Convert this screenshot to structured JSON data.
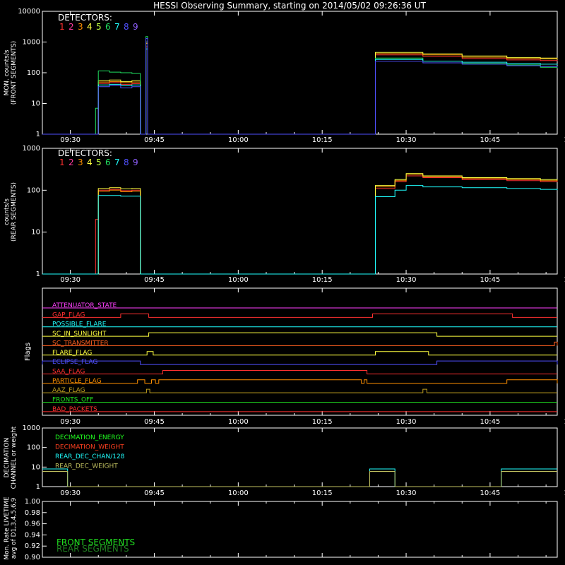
{
  "chart_data": {
    "type": "line",
    "title": "HESSI Observing Summary, starting on 2014/05/02 09:26:36 UT",
    "x_ticks": [
      "09:30",
      "09:45",
      "10:00",
      "10:15",
      "10:30",
      "10:45",
      "11:00"
    ],
    "x_range_minutes": [
      25.0,
      117.0
    ],
    "detectors_label": "DETECTORS:",
    "detector_numbers": [
      "1",
      "2",
      "3",
      "4",
      "5",
      "6",
      "7",
      "8",
      "9"
    ],
    "detector_colors": [
      "#ff3030",
      "#ff3aa0",
      "#ff9000",
      "#ffff40",
      "#c0ff40",
      "#20e060",
      "#20ffff",
      "#5050ff",
      "#9060ff"
    ],
    "panels": [
      {
        "name": "front",
        "ylabel_lines": [
          "MON. counts/s",
          "(FRONT SEGMENTS)"
        ],
        "ytick_labels": [
          "1",
          "10",
          "100",
          "1000",
          "10000"
        ],
        "ytick_values": [
          1,
          10,
          100,
          1000,
          10000
        ],
        "log": true,
        "series": [
          {
            "color": "#ff3030",
            "points": [
              [
                25,
                1
              ],
              [
                35,
                1
              ],
              [
                35,
                45
              ],
              [
                37,
                48
              ],
              [
                39,
                42
              ],
              [
                41,
                44
              ],
              [
                42.5,
                1
              ],
              [
                43.3,
                1
              ],
              [
                43.5,
                700
              ],
              [
                43.8,
                1
              ],
              [
                84.5,
                1
              ],
              [
                84.5,
                380
              ],
              [
                93,
                340
              ],
              [
                100,
                290
              ],
              [
                108,
                260
              ],
              [
                114,
                250
              ],
              [
                117,
                240
              ]
            ]
          },
          {
            "color": "#ff9000",
            "points": [
              [
                25,
                1
              ],
              [
                35,
                1
              ],
              [
                35,
                50
              ],
              [
                37,
                52
              ],
              [
                39,
                48
              ],
              [
                41,
                50
              ],
              [
                42.5,
                1
              ],
              [
                43.3,
                1
              ],
              [
                43.5,
                900
              ],
              [
                43.8,
                1
              ],
              [
                84.5,
                1
              ],
              [
                84.5,
                420
              ],
              [
                93,
                380
              ],
              [
                100,
                320
              ],
              [
                108,
                290
              ],
              [
                114,
                280
              ],
              [
                117,
                270
              ]
            ]
          },
          {
            "color": "#ffff40",
            "points": [
              [
                25,
                1
              ],
              [
                35,
                1
              ],
              [
                35,
                55
              ],
              [
                37,
                58
              ],
              [
                39,
                52
              ],
              [
                41,
                55
              ],
              [
                42.5,
                1
              ],
              [
                43.3,
                1
              ],
              [
                43.5,
                1000
              ],
              [
                43.8,
                1
              ],
              [
                84.5,
                1
              ],
              [
                84.5,
                460
              ],
              [
                93,
                410
              ],
              [
                100,
                350
              ],
              [
                108,
                310
              ],
              [
                114,
                300
              ],
              [
                117,
                290
              ]
            ]
          },
          {
            "color": "#20e060",
            "points": [
              [
                25,
                1
              ],
              [
                34.5,
                1
              ],
              [
                34.5,
                7
              ],
              [
                35,
                7
              ],
              [
                35,
                115
              ],
              [
                37,
                105
              ],
              [
                39,
                100
              ],
              [
                41,
                95
              ],
              [
                42.5,
                80
              ],
              [
                42.5,
                1
              ],
              [
                43.3,
                1
              ],
              [
                43.5,
                1500
              ],
              [
                43.8,
                1
              ],
              [
                84.5,
                1
              ],
              [
                84.5,
                300
              ],
              [
                93,
                240
              ],
              [
                100,
                200
              ],
              [
                108,
                180
              ],
              [
                114,
                150
              ],
              [
                117,
                140
              ]
            ]
          },
          {
            "color": "#20ffff",
            "points": [
              [
                25,
                1
              ],
              [
                35,
                1
              ],
              [
                35,
                40
              ],
              [
                37,
                42
              ],
              [
                39,
                38
              ],
              [
                41,
                40
              ],
              [
                42.5,
                1
              ],
              [
                43.3,
                1
              ],
              [
                43.5,
                600
              ],
              [
                43.8,
                1
              ],
              [
                84.5,
                1
              ],
              [
                84.5,
                270
              ],
              [
                93,
                240
              ],
              [
                100,
                220
              ],
              [
                108,
                200
              ],
              [
                114,
                190
              ],
              [
                117,
                180
              ]
            ]
          },
          {
            "color": "#5050ff",
            "points": [
              [
                25,
                1
              ],
              [
                35,
                1
              ],
              [
                35,
                35
              ],
              [
                37,
                38
              ],
              [
                39,
                32
              ],
              [
                41,
                35
              ],
              [
                42.5,
                1
              ],
              [
                43.3,
                1
              ],
              [
                43.5,
                1300
              ],
              [
                43.8,
                1
              ],
              [
                84.5,
                1
              ],
              [
                84.5,
                240
              ],
              [
                93,
                210
              ],
              [
                100,
                190
              ],
              [
                108,
                170
              ],
              [
                114,
                160
              ],
              [
                117,
                150
              ]
            ]
          }
        ]
      },
      {
        "name": "rear",
        "ylabel_lines": [
          "counts/s",
          "(REAR SEGMENTS)"
        ],
        "ytick_labels": [
          "1",
          "10",
          "100",
          "1000"
        ],
        "ytick_values": [
          1,
          10,
          100,
          1000
        ],
        "log": true,
        "series": [
          {
            "color": "#ff3030",
            "points": [
              [
                25,
                1
              ],
              [
                34.5,
                1
              ],
              [
                34.5,
                20
              ],
              [
                35,
                20
              ],
              [
                35,
                100
              ],
              [
                37,
                105
              ],
              [
                39,
                98
              ],
              [
                41,
                100
              ],
              [
                42.5,
                80
              ],
              [
                42.5,
                1
              ],
              [
                84.5,
                1
              ],
              [
                84.5,
                110
              ],
              [
                88,
                160
              ],
              [
                90,
                220
              ],
              [
                93,
                200
              ],
              [
                100,
                180
              ],
              [
                108,
                170
              ],
              [
                114,
                160
              ],
              [
                117,
                155
              ]
            ]
          },
          {
            "color": "#ff9000",
            "points": [
              [
                25,
                1
              ],
              [
                35,
                1
              ],
              [
                35,
                95
              ],
              [
                37,
                100
              ],
              [
                39,
                92
              ],
              [
                41,
                95
              ],
              [
                42.5,
                1
              ],
              [
                84.5,
                1
              ],
              [
                84.5,
                120
              ],
              [
                88,
                170
              ],
              [
                90,
                240
              ],
              [
                93,
                210
              ],
              [
                100,
                190
              ],
              [
                108,
                180
              ],
              [
                114,
                170
              ],
              [
                117,
                165
              ]
            ]
          },
          {
            "color": "#ffff40",
            "points": [
              [
                25,
                1
              ],
              [
                35,
                1
              ],
              [
                35,
                110
              ],
              [
                37,
                115
              ],
              [
                39,
                108
              ],
              [
                41,
                110
              ],
              [
                42.5,
                1
              ],
              [
                84.5,
                1
              ],
              [
                84.5,
                130
              ],
              [
                88,
                180
              ],
              [
                90,
                250
              ],
              [
                93,
                220
              ],
              [
                100,
                200
              ],
              [
                108,
                190
              ],
              [
                114,
                180
              ],
              [
                117,
                175
              ]
            ]
          },
          {
            "color": "#20ffff",
            "points": [
              [
                25,
                1
              ],
              [
                35,
                1
              ],
              [
                35,
                75
              ],
              [
                37,
                75
              ],
              [
                39,
                72
              ],
              [
                41,
                72
              ],
              [
                42.5,
                30
              ],
              [
                42.5,
                1
              ],
              [
                84.5,
                1
              ],
              [
                84.5,
                70
              ],
              [
                88,
                100
              ],
              [
                90,
                130
              ],
              [
                93,
                120
              ],
              [
                100,
                115
              ],
              [
                108,
                110
              ],
              [
                114,
                105
              ],
              [
                117,
                100
              ]
            ]
          }
        ]
      }
    ],
    "flags": [
      {
        "label": "ATTENUATOR_STATE",
        "color": "#ff40ff",
        "segments": []
      },
      {
        "label": "GAP_FLAG",
        "color": "#ff3030",
        "segments": [
          [
            39,
            44
          ],
          [
            84,
            109
          ]
        ]
      },
      {
        "label": "POSSIBLE_FLARE",
        "color": "#20ffff",
        "segments": []
      },
      {
        "label": "SC_IN_SUNLIGHT",
        "color": "#ffff40",
        "segments": [
          [
            44,
            95.5
          ]
        ]
      },
      {
        "label": "SC_TRANSMITTER",
        "color": "#ff6020",
        "segments": [
          [
            116.5,
            117
          ]
        ]
      },
      {
        "label": "FLARE_FLAG",
        "color": "#ffff40",
        "segments": [
          [
            43.7,
            44.8
          ],
          [
            84.5,
            94
          ]
        ]
      },
      {
        "label": "ECLIPSE_FLAG",
        "color": "#5050ff",
        "segments": [
          [
            25,
            42.5
          ],
          [
            95.5,
            117
          ]
        ]
      },
      {
        "label": "SAA_FLAG",
        "color": "#ff3030",
        "segments": [
          [
            46.5,
            83
          ]
        ]
      },
      {
        "label": "PARTICLE_FLAG",
        "color": "#ff9000",
        "segments": [
          [
            42,
            43.3
          ],
          [
            44.5,
            45.2
          ],
          [
            45.8,
            82
          ],
          [
            82.5,
            83
          ],
          [
            108,
            117
          ]
        ]
      },
      {
        "label": "AAZ_FLAG",
        "color": "#c0a020",
        "segments": [
          [
            43.6,
            44.2
          ],
          [
            93,
            93.7
          ]
        ]
      },
      {
        "label": "FRONTS_OFF",
        "color": "#20e020",
        "segments": []
      },
      {
        "label": "BAD_PACKETS",
        "color": "#ff3030",
        "segments": []
      }
    ],
    "decimation": {
      "ylabel_lines": [
        "DECIMATION",
        "CHANNEL or weight"
      ],
      "ytick_labels": [
        "1",
        "10",
        "100",
        "1000"
      ],
      "ytick_values": [
        1,
        10,
        100,
        1000
      ],
      "legend": [
        {
          "label": "DECIMATION_ENERGY",
          "color": "#20ff20"
        },
        {
          "label": "DECIMATION_WEIGHT",
          "color": "#ff4020"
        },
        {
          "label": "REAR_DEC_CHAN/128",
          "color": "#20ffff"
        },
        {
          "label": "REAR_DEC_WEIGHT",
          "color": "#c0c060"
        }
      ],
      "series": [
        {
          "color": "#20ffff",
          "points": [
            [
              25,
              8
            ],
            [
              29.5,
              8
            ],
            [
              29.5,
              1
            ],
            [
              83.5,
              1
            ],
            [
              83.5,
              8
            ],
            [
              88,
              8
            ],
            [
              88,
              1
            ],
            [
              107,
              1
            ],
            [
              107,
              8
            ],
            [
              117,
              8
            ]
          ]
        },
        {
          "color": "#c0c060",
          "points": [
            [
              25,
              6
            ],
            [
              29.5,
              6
            ],
            [
              29.5,
              1
            ],
            [
              83.5,
              1
            ],
            [
              83.5,
              6
            ],
            [
              88,
              6
            ],
            [
              88,
              1
            ],
            [
              107,
              1
            ],
            [
              107,
              6
            ],
            [
              117,
              6
            ]
          ]
        }
      ]
    },
    "livetime": {
      "ylabel_lines": [
        "Mon. Rate LIVETIME",
        "avg of D1,3,4,5,6,9"
      ],
      "ytick_labels": [
        "0.90",
        "0.92",
        "0.94",
        "0.96",
        "0.98",
        "1.00"
      ],
      "ytick_values": [
        0.9,
        0.92,
        0.94,
        0.96,
        0.98,
        1.0
      ],
      "legend": [
        {
          "label": "FRONT SEGMENTS",
          "color": "#20e020"
        },
        {
          "label": "REAR SEGMENTS",
          "color": "#208020"
        }
      ]
    }
  }
}
